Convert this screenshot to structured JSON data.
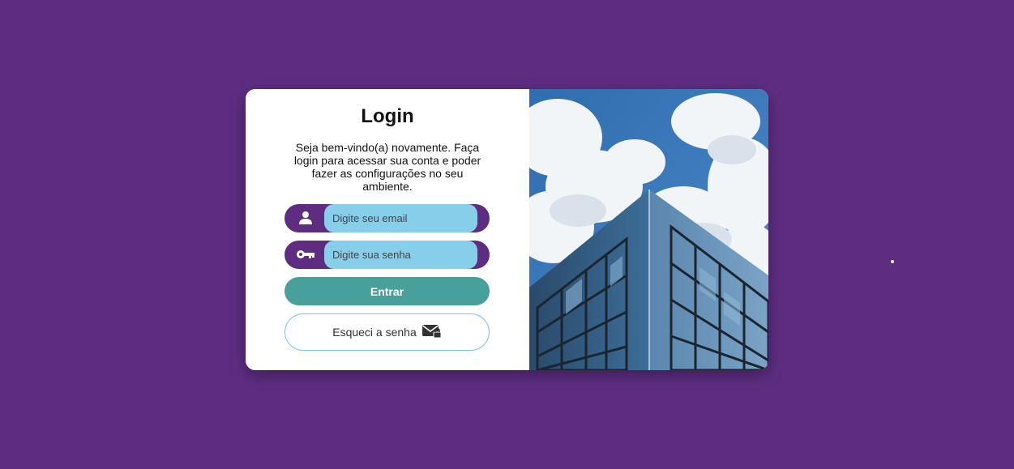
{
  "login": {
    "title": "Login",
    "subtitle": "Seja bem-vindo(a) novamente. Faça login para acessar sua conta e poder fazer as configurações no seu ambiente.",
    "email": {
      "placeholder": "Digite seu email",
      "icon": "user-icon"
    },
    "password": {
      "placeholder": "Digite sua senha",
      "icon": "key-icon"
    },
    "submit_label": "Entrar",
    "forgot_label": "Esqueci a senha",
    "forgot_icon": "mail-lock-icon"
  },
  "image": {
    "subject": "glass-office-building"
  },
  "colors": {
    "background": "#5e2d82",
    "input_bg": "#87ceeb",
    "submit": "#48a09c",
    "forgot_border": "#7cc3e6"
  }
}
